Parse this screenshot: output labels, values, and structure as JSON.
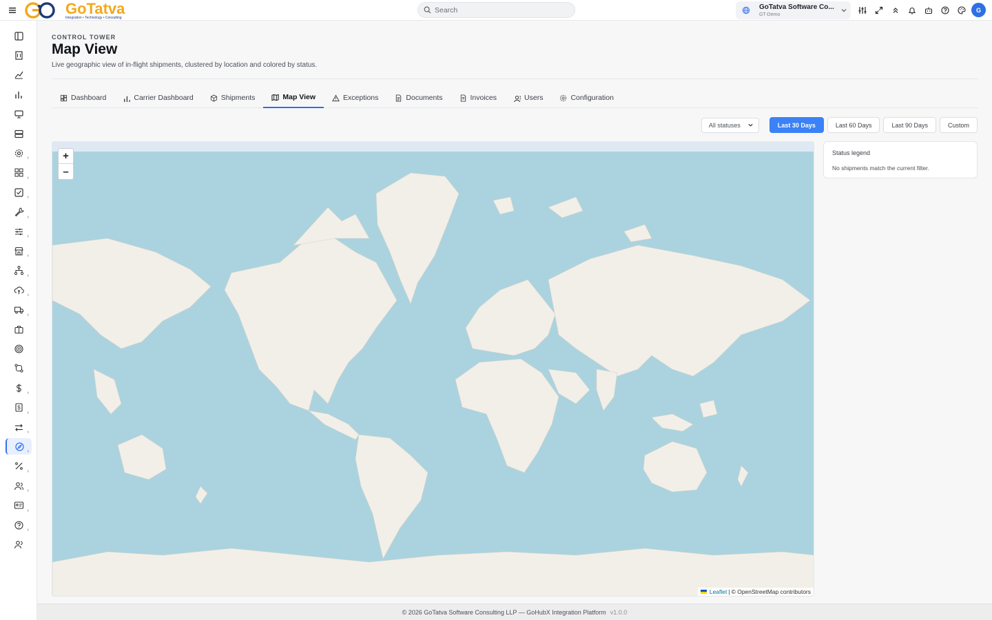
{
  "app": {
    "logo_text": "GoTatva",
    "logo_tagline": "Integration • Technology • Consulting",
    "brand_color": "#2f6fe4",
    "accent_color": "#3b82f6"
  },
  "topbar": {
    "search_placeholder": "Search",
    "tenant_name": "GoTatva Software Co...",
    "tenant_code": "GT-Demo",
    "avatar_initial": "G",
    "icons": [
      "sliders-icon",
      "expand-icon",
      "chevrons-up-icon",
      "bell-icon",
      "bot-icon",
      "help-icon",
      "palette-icon"
    ]
  },
  "sidebar": {
    "items": [
      {
        "icon": "panel-left-icon",
        "caret": ""
      },
      {
        "icon": "building-icon",
        "caret": ""
      },
      {
        "icon": "line-chart-icon",
        "caret": ""
      },
      {
        "icon": "bar-chart-icon",
        "caret": ""
      },
      {
        "icon": "monitor-icon",
        "caret": ""
      },
      {
        "icon": "server-icon",
        "caret": ""
      },
      {
        "icon": "settings-icon",
        "caret": "›"
      },
      {
        "icon": "grid-icon",
        "caret": "›"
      },
      {
        "icon": "check-square-icon",
        "caret": "›"
      },
      {
        "icon": "wrench-icon",
        "caret": "›"
      },
      {
        "icon": "sliders-horizontal-icon",
        "caret": "›"
      },
      {
        "icon": "store-icon",
        "caret": "›"
      },
      {
        "icon": "network-icon",
        "caret": "›"
      },
      {
        "icon": "cloud-upload-icon",
        "caret": "›"
      },
      {
        "icon": "truck-icon",
        "caret": "›"
      },
      {
        "icon": "briefcase-icon",
        "caret": ""
      },
      {
        "icon": "target-icon",
        "caret": ""
      },
      {
        "icon": "git-compare-icon",
        "caret": ""
      },
      {
        "icon": "dollar-icon",
        "caret": "›"
      },
      {
        "icon": "receipt-icon",
        "caret": "›"
      },
      {
        "icon": "arrows-exchange-icon",
        "caret": "›"
      },
      {
        "icon": "compass-icon",
        "caret": "›",
        "active": true
      },
      {
        "icon": "percent-icon",
        "caret": "›"
      },
      {
        "icon": "users-icon",
        "caret": "›"
      },
      {
        "icon": "id-card-icon",
        "caret": "›"
      },
      {
        "icon": "help-circle-icon",
        "caret": "›"
      },
      {
        "icon": "user-group-icon",
        "caret": ""
      }
    ]
  },
  "page": {
    "eyebrow": "CONTROL TOWER",
    "title": "Map View",
    "subtitle": "Live geographic view of in-flight shipments, clustered by location and colored by status."
  },
  "tabs": [
    {
      "label": "Dashboard",
      "icon": "dashboard-icon"
    },
    {
      "label": "Carrier Dashboard",
      "icon": "bar-chart-icon"
    },
    {
      "label": "Shipments",
      "icon": "package-icon"
    },
    {
      "label": "Map View",
      "icon": "map-icon",
      "active": true
    },
    {
      "label": "Exceptions",
      "icon": "alert-triangle-icon"
    },
    {
      "label": "Documents",
      "icon": "file-icon"
    },
    {
      "label": "Invoices",
      "icon": "file-text-icon"
    },
    {
      "label": "Users",
      "icon": "users-icon"
    },
    {
      "label": "Configuration",
      "icon": "gear-icon"
    }
  ],
  "filters": {
    "status_select": "All statuses",
    "ranges": [
      "Last 30 Days",
      "Last 60 Days",
      "Last 90 Days",
      "Custom"
    ],
    "active_range": "Last 30 Days"
  },
  "map": {
    "zoom_in": "+",
    "zoom_out": "–",
    "attribution_link": "Leaflet",
    "attribution_sep": "|",
    "attribution_text": "© OpenStreetMap contributors",
    "ocean_color": "#aad3df",
    "land_color": "#f2efe9"
  },
  "legend": {
    "title": "Status legend",
    "empty": "No shipments match the current filter."
  },
  "footer": {
    "text": "© 2026 GoTatva Software Consulting LLP — GoHubX Integration Platform",
    "version": "v1.0.0"
  }
}
